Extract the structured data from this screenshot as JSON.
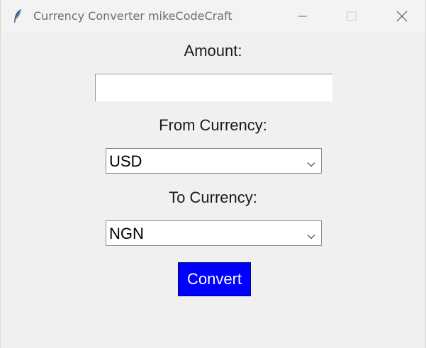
{
  "window": {
    "title": "Currency Converter mikeCodeCraft",
    "app_icon": "feather-icon",
    "controls": [
      "minimize-icon",
      "maximize-icon",
      "close-icon"
    ]
  },
  "form": {
    "amount_label": "Amount:",
    "amount_value": "",
    "from_label": "From Currency:",
    "from_value": "USD",
    "to_label": "To Currency:",
    "to_value": "NGN",
    "convert_label": "Convert"
  },
  "colors": {
    "window_bg": "#f0f0f0",
    "button_bg": "#0000ff",
    "button_text": "#ffffff"
  }
}
